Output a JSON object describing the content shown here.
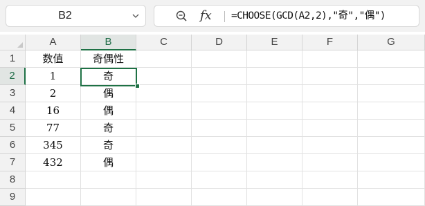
{
  "toolbar": {
    "name_box": "B2",
    "fx_label": "fx",
    "formula": "=CHOOSE(GCD(A2,2),\"奇\",\"偶\")"
  },
  "columns": [
    "A",
    "B",
    "C",
    "D",
    "E",
    "F",
    "G"
  ],
  "rows": [
    "1",
    "2",
    "3",
    "4",
    "5",
    "6",
    "7",
    "8",
    "9"
  ],
  "selected_cell": "B2",
  "cells": [
    [
      "数值",
      "奇偶性"
    ],
    [
      "1",
      "奇"
    ],
    [
      "2",
      "偶"
    ],
    [
      "16",
      "偶"
    ],
    [
      "77",
      "奇"
    ],
    [
      "345",
      "奇"
    ],
    [
      "432",
      "偶"
    ],
    [
      "",
      ""
    ],
    [
      "",
      ""
    ]
  ],
  "colors": {
    "accent": "#1e7145",
    "header_bg": "#f2f2f2",
    "gridline": "#e1e1e1"
  }
}
